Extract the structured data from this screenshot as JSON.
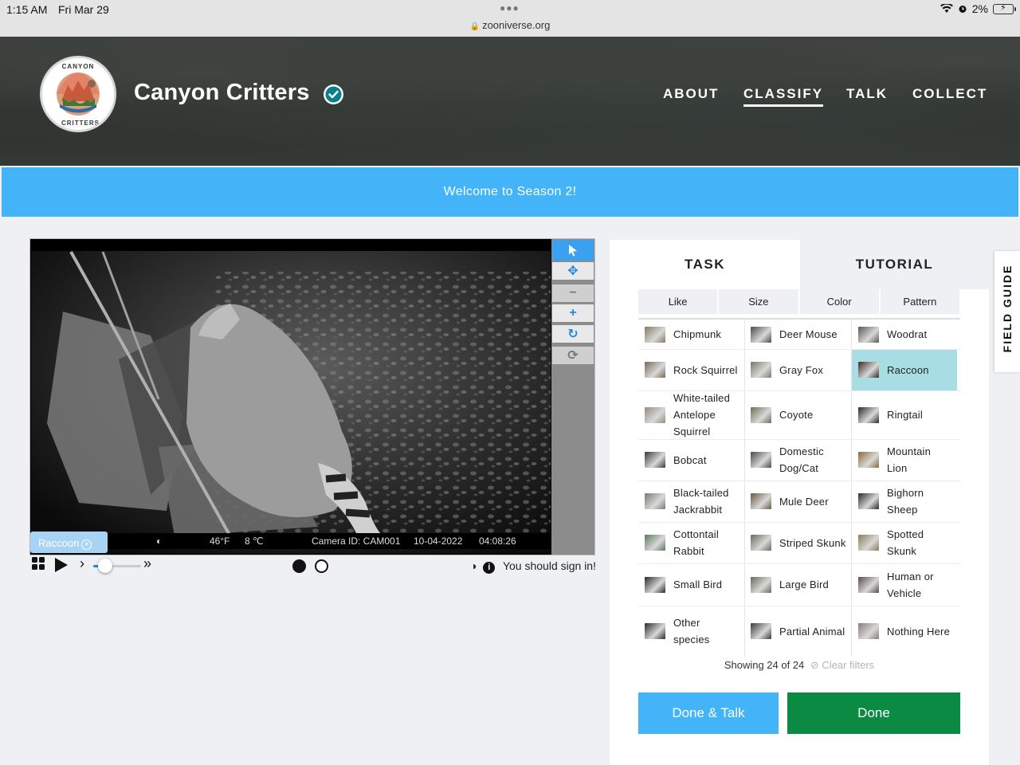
{
  "statusbar": {
    "time": "1:15 AM",
    "date": "Fri Mar 29",
    "url": "zooniverse.org",
    "battery": "2%"
  },
  "header": {
    "logo_text": "CANYON CRITTERS",
    "title": "Canyon Critters",
    "nav": {
      "about": "ABOUT",
      "classify": "CLASSIFY",
      "talk": "TALK",
      "collect": "COLLECT"
    }
  },
  "banner": {
    "text": "Welcome to Season 2!"
  },
  "viewer": {
    "temperature_f": "46°F",
    "temperature_c": "8 ℃",
    "camera_id": "Camera ID: CAM001",
    "date": "10-04-2022",
    "time": "04:08:26",
    "tag": "Raccoon",
    "signin_text": "You should sign in!"
  },
  "tabs": {
    "task": "TASK",
    "tutorial": "TUTORIAL"
  },
  "filters": [
    "Like",
    "Size",
    "Color",
    "Pattern"
  ],
  "species": [
    {
      "name": "Chipmunk",
      "color": "#8a7a62"
    },
    {
      "name": "Deer Mouse",
      "color": "#4a4a4a"
    },
    {
      "name": "Woodrat",
      "color": "#5a5550"
    },
    {
      "name": "Rock Squirrel",
      "color": "#7a6a52"
    },
    {
      "name": "Gray Fox",
      "color": "#7a7a68"
    },
    {
      "name": "Raccoon",
      "color": "#3a2a22"
    },
    {
      "name": "White-tailed Antelope Squirrel",
      "color": "#9a8a7a"
    },
    {
      "name": "Coyote",
      "color": "#6b7050"
    },
    {
      "name": "Ringtail",
      "color": "#2a2a2a"
    },
    {
      "name": "Bobcat",
      "color": "#3a3a3a"
    },
    {
      "name": "Domestic Dog/Cat",
      "color": "#4a4a4a"
    },
    {
      "name": "Mountain Lion",
      "color": "#8a6a3a"
    },
    {
      "name": "Black-tailed Jackrabbit",
      "color": "#7a7a72"
    },
    {
      "name": "Mule Deer",
      "color": "#6a5a40"
    },
    {
      "name": "Bighorn Sheep",
      "color": "#2a2a2a"
    },
    {
      "name": "Cottontail Rabbit",
      "color": "#5a7a5a"
    },
    {
      "name": "Striped Skunk",
      "color": "#6a6a5a"
    },
    {
      "name": "Spotted Skunk",
      "color": "#8a7a5a"
    },
    {
      "name": "Small Bird",
      "color": "#2a2a2a"
    },
    {
      "name": "Large Bird",
      "color": "#6a6a5a"
    },
    {
      "name": "Human or Vehicle",
      "color": "#5a4a4a"
    },
    {
      "name": "Other species",
      "color": "#2a2a2a"
    },
    {
      "name": "Partial Animal",
      "color": "#3a3a3a"
    },
    {
      "name": "Nothing Here",
      "color": "#8a7a7a"
    }
  ],
  "showing": {
    "text": "Showing 24 of 24",
    "clear": "Clear filters"
  },
  "buttons": {
    "done_talk": "Done & Talk",
    "done": "Done"
  },
  "field_guide": "FIELD GUIDE",
  "colors": {
    "accent": "#43b4f7",
    "done": "#0a8a43",
    "selected": "#a8dde3"
  }
}
